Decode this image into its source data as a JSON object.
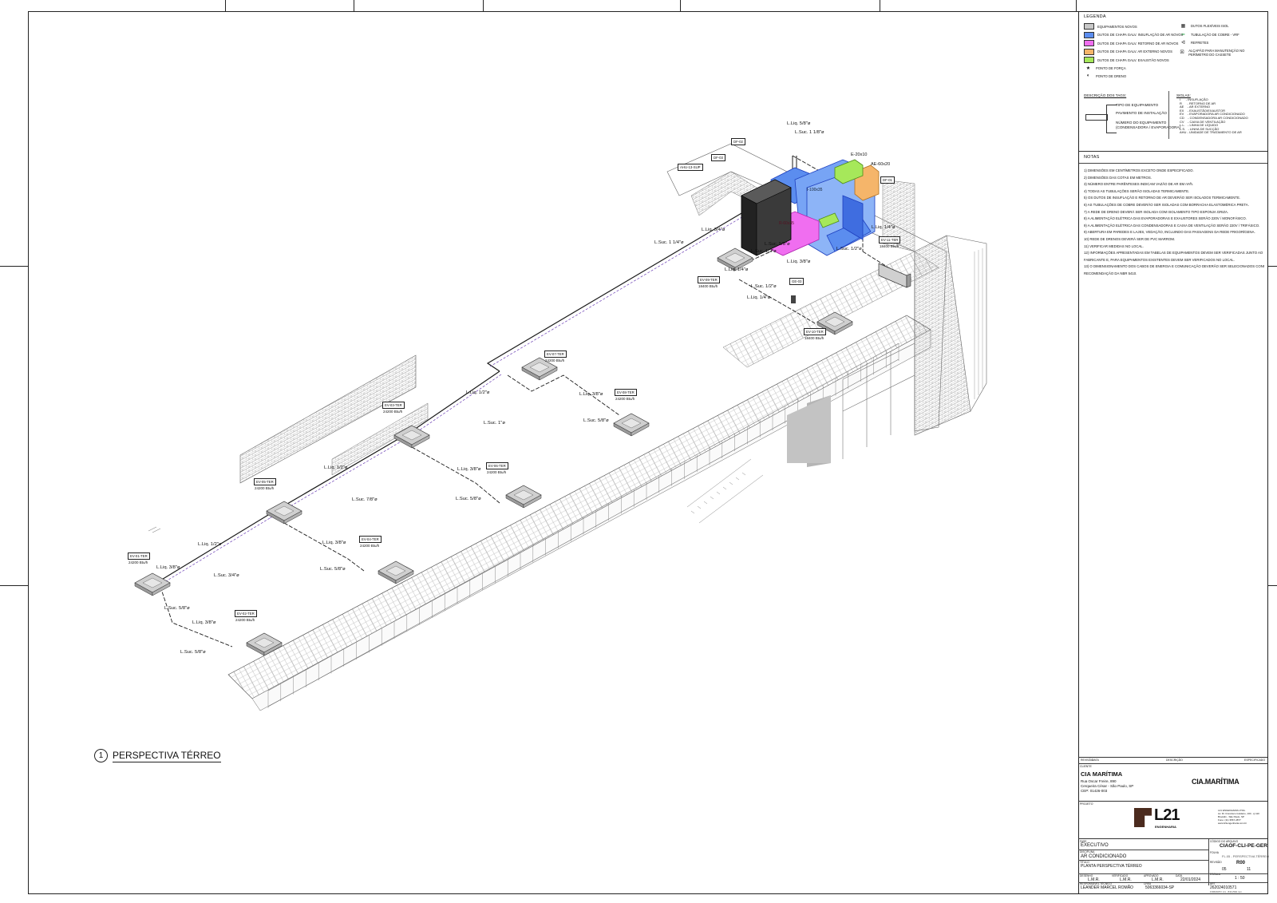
{
  "sheet": {
    "view_number": "1",
    "view_title": "PERSPECTIVA TÉRREO"
  },
  "legend": {
    "title": "LEGENDA",
    "items_left": [
      {
        "label": "EQUIPAMENTOS NOVOS",
        "color": "#c8c8c8"
      },
      {
        "label": "DUTOS DE CHAPA GALV. INSUFLAÇÃO DE AR NOVOS",
        "color": "#5b8def"
      },
      {
        "label": "DUTOS DE CHAPA GALV. RETORNO DE AR NOVOS",
        "color": "#f06ef0"
      },
      {
        "label": "DUTOS DE CHAPA GALV. AR EXTERNO NOVOS",
        "color": "#f5b56a"
      },
      {
        "label": "DUTOS DE CHAPA GALV. EXAUSTÃO NOVOS",
        "color": "#a6e85a"
      },
      {
        "label": "PONTO DE FORÇA",
        "color": ""
      },
      {
        "label": "PONTO DE DRENO",
        "color": ""
      }
    ],
    "items_right": [
      {
        "label": "DUTOS FLEXÍVEIS ISOL"
      },
      {
        "label": "TUBULAÇÃO DE COBRE - VRF"
      },
      {
        "label": "REFRETES"
      },
      {
        "label": "ALÇAPÃO PARA MANUTENÇÃO NO PERÍMETRO DO CASSETE"
      }
    ],
    "tag_desc_title": "DESCRIÇÃO DOS TAGS:",
    "tag_desc": [
      "TIPO DE EQUIPAMENTO",
      "PAVIMENTO DE INSTALAÇÃO",
      "NÚMERO DO EQUIPAMENTO",
      "(CONDENSADORA / EVAPORADORA)"
    ],
    "siglas_title": "SIGLAS:",
    "siglas": [
      "I      - INSUFLAÇÃO",
      "R      - RETORNO DE AR",
      "AE    - AR EXTERNO",
      "EX    - EXAUSTÃO/EXAUSTOR",
      "EV    - EVAPORADORA AR CONDICIONADO",
      "CD    - CONDENSADORA AR CONDICIONADO",
      "CV    - CAIXA DE VENTILAÇÃO",
      "L.L.   - LINHA DE LÍQUIDO",
      "L.S.   - LINHA DE SUCÇÃO",
      "AHU - UNIDADE DE TRATAMENTO DE AR"
    ]
  },
  "notes": {
    "title": "NOTAS",
    "items": [
      "1) DIMENSÕES EM CENTÍMETROS EXCETO ONDE ESPECIFICADO.",
      "2) DIMENSÕES DAS COTAS EM METROS.",
      "3) NÚMERO ENTRE PARÊNTESES INDICAM VAZÃO DE AR EM m³/h.",
      "4) TODAS AS TUBULAÇÕES SERÃO ISOLADAS TERMICAMENTE.",
      "5) OS DUTOS DE INSUFLAÇÃO E RETORNO DE AR DEVERÃO SER ISOLADOS TERMICAMENTE.",
      "6) AS TUBULAÇÕES DE COBRE DEVERÃO SER ISOLADAS COM BORRACHA ELASTOMÉRICA PRETA.",
      "7) A REDE DE DRENO DEVERÁ SER ISOLADA COM ISOLAMENTO TIPO ESPONJA GRIZA.",
      "8) A ALIMENTAÇÃO ELÉTRICA DAS EVAPORADORAS E EXAUSTORES SERÃO 220V / MONOFÁSICO.",
      "9) A ALIMENTAÇÃO ELÉTRICA DAS CONDENSADORAS E CAIXA DE VENTILAÇÃO SERÃO 220V / TRIFÁSICO.",
      "9) ABERTURA EM PAREDES E LAJES, VEDAÇÃO, INCLUINDO DAS PASSAGENS DA REDE FRIGORÍGENA.",
      "10) REDE DE DRENOS DEVERÁ SER DE PVC MARROM.",
      "11) VERIFICAR MEDIDAS NO LOCAL.",
      "12) INFORMAÇÕES APRESENTADAS EM TABELAS DE EQUIPAMENTOS DEVEM SER VERIFICADAS JUNTO AO",
      "FABRICANTE E, PARA EQUIPAMENTOS EXISTENTES DEVEM SER VERIFICADOS NO LOCAL.",
      "13) O DIMENSIONAMENTO DOS CABOS DE ENERGIA E COMUNICAÇÃO DEVERÃO SER SELECIONADOS CONFORME",
      "RECOMENDAÇÃO DA NBR 5410."
    ]
  },
  "equipment": [
    {
      "tag": "EV-01-TER",
      "cap": "24200 Btu/h"
    },
    {
      "tag": "EV-02-TER",
      "cap": "24200 Btu/h"
    },
    {
      "tag": "EV-03-TER",
      "cap": "24200 Btu/h"
    },
    {
      "tag": "EV-04-TER",
      "cap": "24200 Btu/h"
    },
    {
      "tag": "EV-05-TER",
      "cap": "24200 Btu/h"
    },
    {
      "tag": "EV-06-TER",
      "cap": "24200 Btu/h"
    },
    {
      "tag": "EV-07-TER",
      "cap": "24200 Btu/h"
    },
    {
      "tag": "EV-08-TER",
      "cap": "24200 Btu/h"
    },
    {
      "tag": "EV-09-TER",
      "cap": "18400 Btu/h"
    },
    {
      "tag": "EV-10-TER",
      "cap": "18400 Btu/h"
    },
    {
      "tag": "EV-11-TER",
      "cap": "18400 Btu/h"
    }
  ],
  "tags_misc": [
    "DF-02",
    "DF-03",
    "AHU-13-SUP",
    "E-20x10",
    "AE-60x20",
    "DF-01",
    "GE-03"
  ],
  "pipe_labels": {
    "top": [
      "L.Liq. 5/8\"ø",
      "L.Suc. 1 1/8\"ø"
    ],
    "ahu": [
      "L.Liq. 3/4\"ø",
      "L.Suc. 1 1/4\"ø"
    ],
    "ev09": [
      "L.Suc. 5/8\"ø",
      "L.Suc. 1/2\"ø",
      "L.Liq. 1/4\"ø",
      "L.Liq. 3/8\"ø"
    ],
    "ev10": [
      "L.Suc. 1/2\"ø",
      "L.Liq. 1/4\"ø"
    ],
    "ev11": [
      "L.Liq. 1/4\"ø",
      "L.Suc. 1/2\"ø"
    ],
    "main1": [
      "L.Liq. 1/2\"ø",
      "L.Suc. 1\"ø"
    ],
    "ev08": [
      "L.Liq. 3/8\"ø",
      "L.Suc. 5/8\"ø"
    ],
    "main2": [
      "L.Liq. 1/2\"ø",
      "L.Suc. 7/8\"ø"
    ],
    "ev06": [
      "L.Liq. 3/8\"ø",
      "L.Suc. 5/8\"ø"
    ],
    "main3": [
      "L.Liq. 1/2\"ø",
      "L.Suc. 3/4\"ø"
    ],
    "ev04": [
      "L.Liq. 3/8\"ø",
      "L.Suc. 5/8\"ø"
    ],
    "ev01": [
      "L.Liq. 3/8\"ø",
      "L.Suc. 5/8\"ø"
    ],
    "ev02": [
      "L.Liq. 3/8\"ø",
      "L.Suc. 5/8\"ø"
    ],
    "ahu_duct": "I-100x35",
    "ret_duct": "R-60x35"
  },
  "title_block": {
    "client_label": "CLIENTE",
    "client": "CIA MARÍTIMA",
    "address1": "Rua Oscar Freire, 890",
    "address2": "Cerqueira César - São Paulo, SP",
    "address3": "CEP: 01426-003",
    "logo_client": "CIA.MARÍTIMA",
    "project_label": "PROJETO",
    "logo_eng": "L21",
    "logo_eng_sub": "ENGENHARIA",
    "eng_info": [
      "L21 ENGENHARIA LTDA.",
      "Av. Dr. Francisco Goldeiro, 100 - cj 110",
      "Brooklin - São Paulo, SP",
      "Fone: (11) 3567-4877",
      "www.l21engenharia.com.br"
    ],
    "phase_label": "FASE",
    "phase": "EXECUTIVO",
    "discipline_label": "DISCIPLINA",
    "discipline": "AR CONDICIONADO",
    "title_label": "TÍTULO",
    "title": "PLANTA PERSPECTIVA TÉRREO",
    "file_code_label": "CÓDIGO DO ARQUIVO",
    "file_code": "CIAOF-CLI-PE-GER",
    "sheet_label": "FOLHA",
    "sheet": "FL.05 - PERSPECTIVA TÉRREO",
    "rev_label": "REVISÃO",
    "rev": "R00",
    "page": "05",
    "pages": "11",
    "scale_label": "ESCALA",
    "scale": "1 : 50",
    "drawn_label": "DESENHO",
    "drawn": "L.M.R.",
    "checked_label": "VERIFICADO",
    "checked": "L.M.R.",
    "approved_label": "APROVADO",
    "approved": "L.M.R.",
    "date_label": "DATA",
    "date": "22/01/2024",
    "resp_label": "RESPONSÁVEL TÉCNICO",
    "resp": "LEANDER MARCEL ROMÃO",
    "crea_label": "CREA",
    "crea": "5063366034-SP",
    "art_label": "ART",
    "art": "262024010571",
    "format": "FORMATO: A1 - 841x594 mm",
    "rev_header": [
      "REVISÃO",
      "DATA",
      "DESCRIÇÃO",
      "ESPECIFICADO"
    ]
  },
  "colors": {
    "supply": "#5b8def",
    "return": "#f06ef0",
    "outside": "#f5b56a",
    "exhaust": "#a6e85a",
    "equipment": "#3a3a3a",
    "pipe_suction": "#1b1b1b",
    "pipe_liquid": "#6b3fb5"
  }
}
